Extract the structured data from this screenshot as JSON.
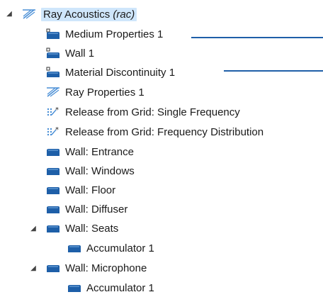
{
  "tree": {
    "root": {
      "label": "Ray Acoustics",
      "tag": "(rac)",
      "expanded": true
    },
    "items": [
      {
        "label": "Medium Properties 1",
        "icon": "domain-wall-icon"
      },
      {
        "label": "Wall 1",
        "icon": "boundary-wall-icon"
      },
      {
        "label": "Material Discontinuity 1",
        "icon": "boundary-wall-icon"
      },
      {
        "label": "Ray Properties 1",
        "icon": "ray-properties-icon"
      },
      {
        "label": "Release from Grid: Single Frequency",
        "icon": "release-grid-icon"
      },
      {
        "label": "Release from Grid: Frequency Distribution",
        "icon": "release-grid-icon"
      },
      {
        "label": "Wall: Entrance",
        "icon": "wall-icon"
      },
      {
        "label": "Wall: Windows",
        "icon": "wall-icon"
      },
      {
        "label": "Wall: Floor",
        "icon": "wall-icon"
      },
      {
        "label": "Wall: Diffuser",
        "icon": "wall-icon"
      },
      {
        "label": "Wall: Seats",
        "icon": "wall-icon",
        "expanded": true,
        "children": [
          {
            "label": "Accumulator 1",
            "icon": "accumulator-icon"
          }
        ]
      },
      {
        "label": "Wall: Microphone",
        "icon": "wall-icon",
        "expanded": true,
        "children": [
          {
            "label": "Accumulator 1",
            "icon": "accumulator-icon"
          }
        ]
      }
    ]
  },
  "colors": {
    "selection": "#cfe6fb",
    "callout_line": "#1f5fa8",
    "wall_icon_blue": "#1e5fa8"
  }
}
